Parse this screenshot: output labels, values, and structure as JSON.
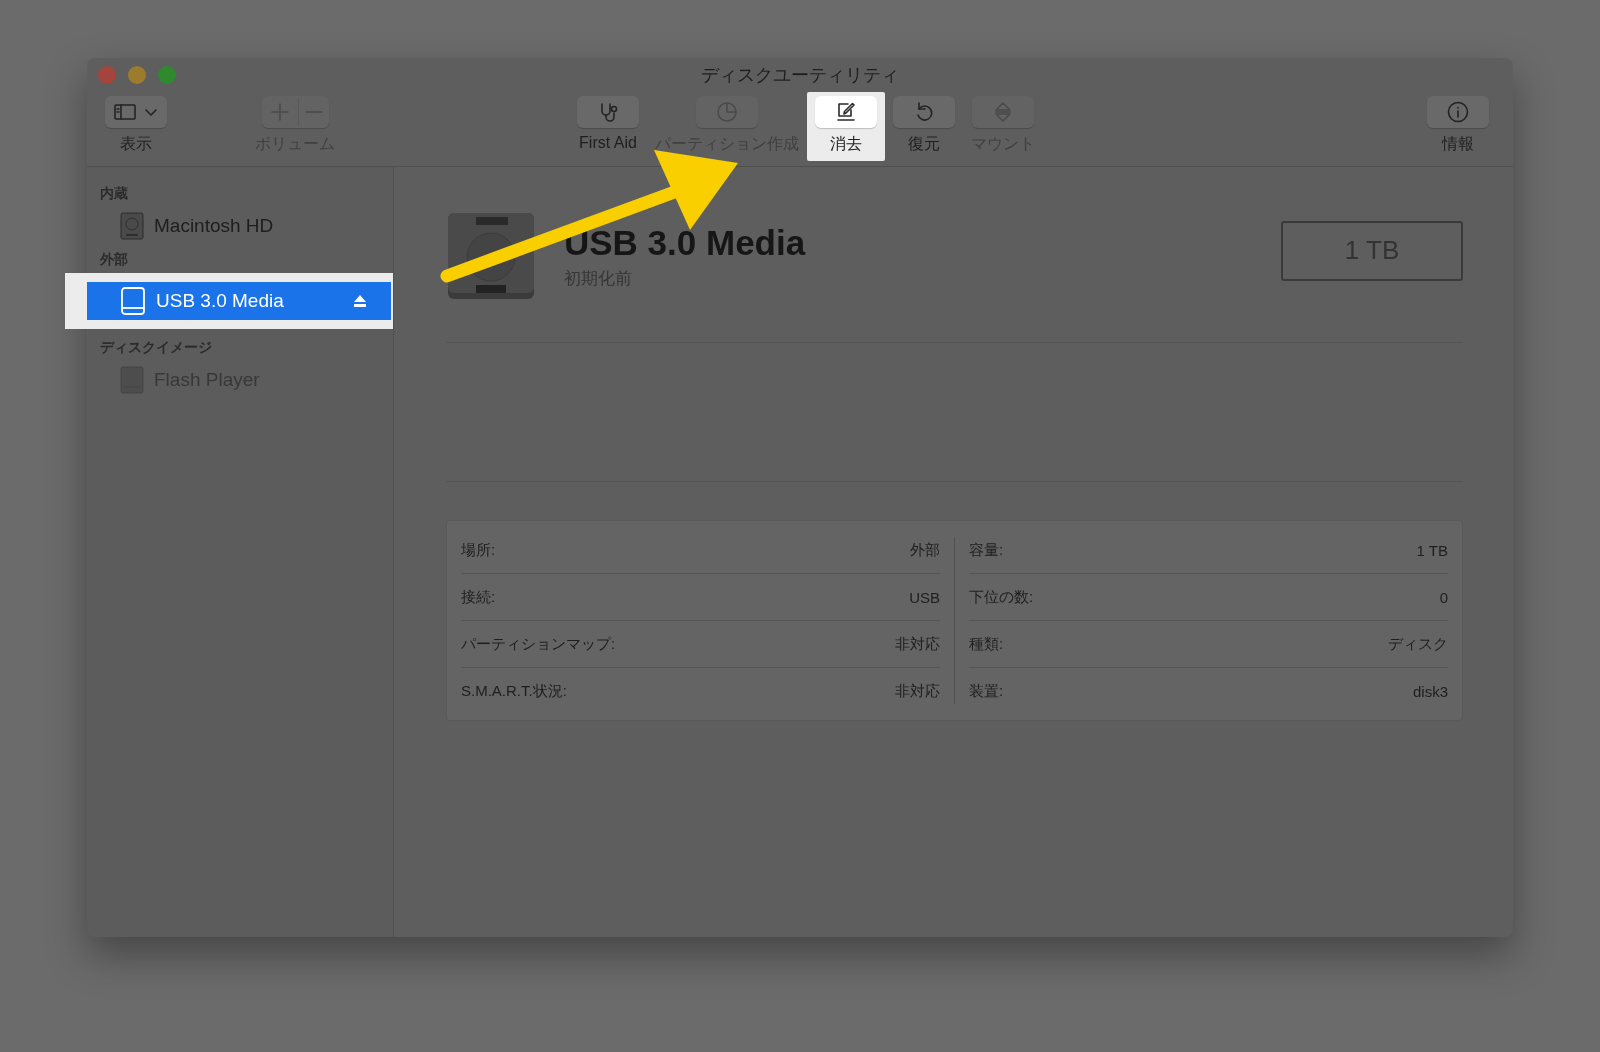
{
  "window": {
    "title": "ディスクユーティリティ"
  },
  "toolbar": [
    {
      "label": "表示",
      "kind": "view",
      "disabled": false,
      "highlighted": false
    },
    {
      "label": "ボリューム",
      "kind": "volume",
      "disabled": true,
      "highlighted": false
    },
    {
      "label": "First Aid",
      "kind": "firstaid",
      "disabled": false,
      "highlighted": false
    },
    {
      "label": "パーティション作成",
      "kind": "partition",
      "disabled": true,
      "highlighted": false
    },
    {
      "label": "消去",
      "kind": "erase",
      "disabled": false,
      "highlighted": true
    },
    {
      "label": "復元",
      "kind": "restore",
      "disabled": false,
      "highlighted": false
    },
    {
      "label": "マウント",
      "kind": "mount",
      "disabled": true,
      "highlighted": false
    },
    {
      "label": "情報",
      "kind": "info",
      "disabled": false,
      "highlighted": false
    }
  ],
  "sidebar": [
    {
      "heading": "内蔵",
      "items": [
        {
          "name": "Macintosh HD",
          "kind": "internal",
          "selected": false,
          "disabled": false,
          "ejectable": false,
          "highlighted": false
        }
      ]
    },
    {
      "heading": "外部",
      "items": [
        {
          "name": "USB 3.0 Media",
          "kind": "external",
          "selected": true,
          "disabled": false,
          "ejectable": true,
          "highlighted": true
        }
      ]
    },
    {
      "heading": "ディスクイメージ",
      "items": [
        {
          "name": "Flash Player",
          "kind": "image",
          "selected": false,
          "disabled": true,
          "ejectable": false,
          "highlighted": false
        }
      ]
    }
  ],
  "disk": {
    "name": "USB 3.0 Media",
    "status": "初期化前",
    "capacity": "1 TB"
  },
  "info": {
    "left": [
      {
        "label": "場所:",
        "value": "外部"
      },
      {
        "label": "接続:",
        "value": "USB"
      },
      {
        "label": "パーティションマップ:",
        "value": "非対応"
      },
      {
        "label": "S.M.A.R.T.状況:",
        "value": "非対応"
      }
    ],
    "right": [
      {
        "label": "容量:",
        "value": "1 TB"
      },
      {
        "label": "下位の数:",
        "value": "0"
      },
      {
        "label": "種類:",
        "value": "ディスク"
      },
      {
        "label": "装置:",
        "value": "disk3"
      }
    ]
  }
}
